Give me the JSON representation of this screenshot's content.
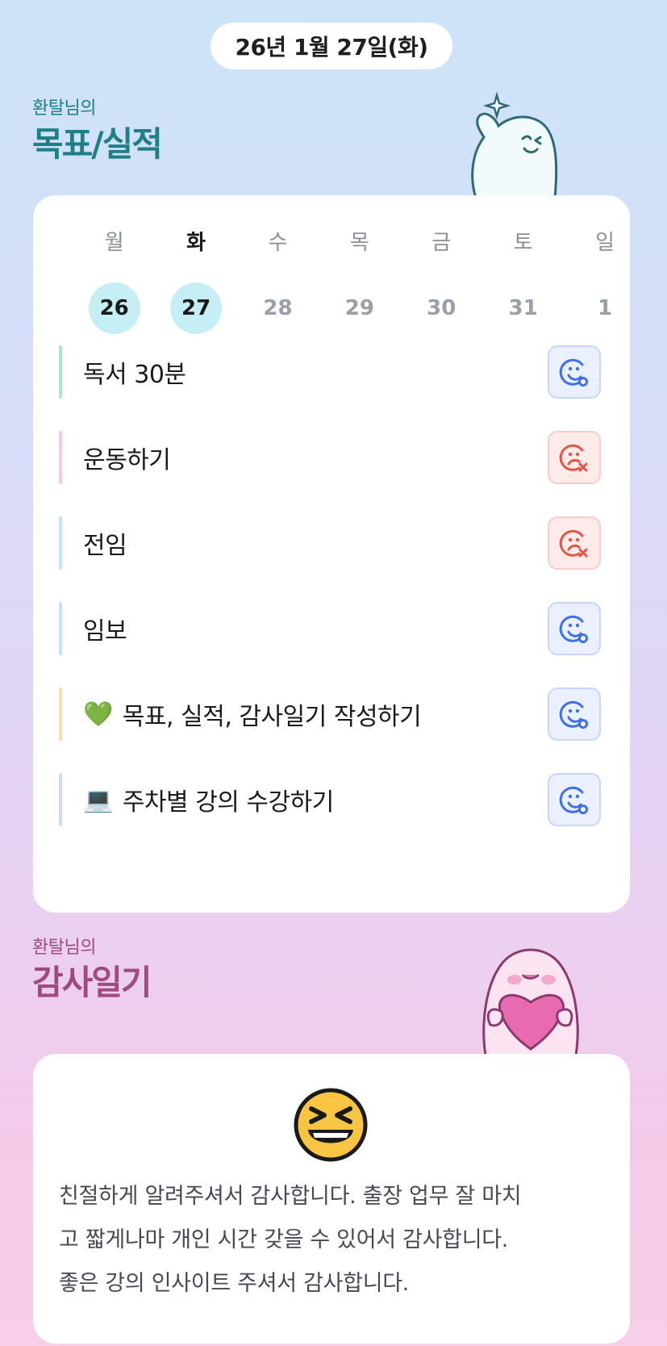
{
  "header": {
    "date": "26년 1월 27일(화)"
  },
  "goals_section": {
    "subtitle": "환탈님의",
    "title": "목표/실적"
  },
  "week": {
    "weekdays": [
      "월",
      "화",
      "수",
      "목",
      "금",
      "토",
      "일"
    ],
    "days": [
      "26",
      "27",
      "28",
      "29",
      "30",
      "31",
      "1"
    ],
    "active_days": [
      "26",
      "27"
    ],
    "today_weekday": "화"
  },
  "goals": [
    {
      "label": "독서 30분",
      "emoji": "",
      "status": "done",
      "accent": "#a9e5cf"
    },
    {
      "label": "운동하기",
      "emoji": "",
      "status": "fail",
      "accent": "#f7c6e3"
    },
    {
      "label": "전임",
      "emoji": "",
      "status": "fail",
      "accent": "#bfe7f2"
    },
    {
      "label": "임보",
      "emoji": "",
      "status": "done",
      "accent": "#bfe7f2"
    },
    {
      "label": "목표, 실적, 감사일기 작성하기",
      "emoji": "💚",
      "status": "done",
      "accent": "#f8ddb0"
    },
    {
      "label": "주차별 강의 수강하기",
      "emoji": "💻",
      "status": "done",
      "accent": "#cfdcf6"
    }
  ],
  "diary_section": {
    "subtitle": "환탈님의",
    "title": "감사일기"
  },
  "diary": {
    "mood_icon": "laughing-squint-emoji",
    "lines": [
      "친절하게 알려주셔서 감사합니다. 출장 업무 잘 마치",
      "고 짧게나마 개인 시간 갖을 수 있어서 감사합니다.",
      "좋은 강의 인사이트 주셔서 감사합니다."
    ]
  },
  "colors": {
    "done_icon": "#3f6fe8",
    "fail_icon": "#e0574a",
    "title_teal": "#1f7e86",
    "title_plum": "#a14a7f"
  }
}
